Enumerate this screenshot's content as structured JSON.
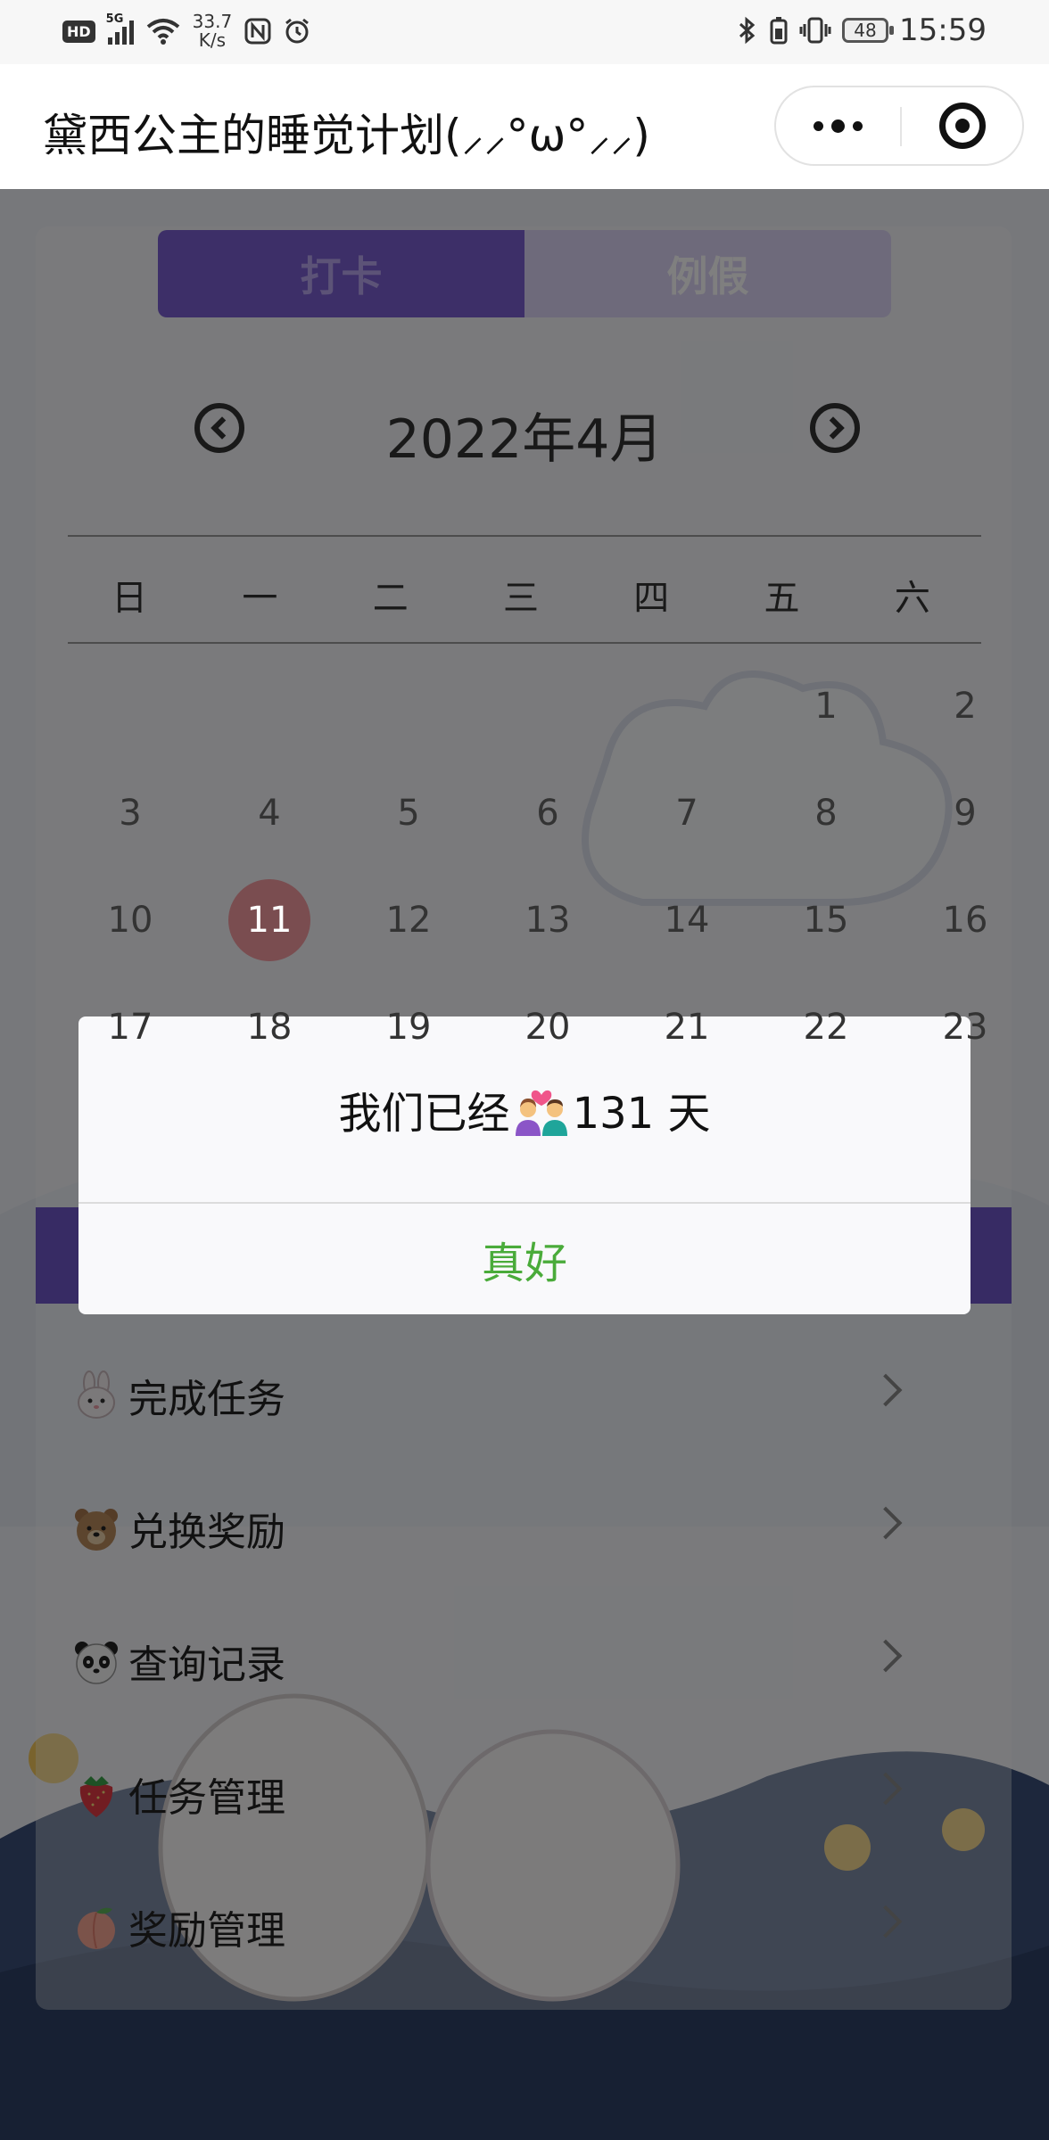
{
  "status_bar": {
    "hd": "HD",
    "network": "5G",
    "speed_value": "33.7",
    "speed_unit": "K/s",
    "battery": "48",
    "time": "15:59"
  },
  "nav": {
    "title": "黛西公主的睡觉计划(⸝⸝°ω°⸝⸝)"
  },
  "tabs": {
    "checkin": "打卡",
    "holiday": "例假"
  },
  "calendar": {
    "month_title": "2022年4月",
    "weekdays": [
      "日",
      "一",
      "二",
      "三",
      "四",
      "五",
      "六"
    ],
    "rows": [
      [
        "",
        "",
        "",
        "",
        "",
        "1",
        "2"
      ],
      [
        "3",
        "4",
        "5",
        "6",
        "7",
        "8",
        "9"
      ],
      [
        "10",
        "11",
        "12",
        "13",
        "14",
        "15",
        "16"
      ],
      [
        "17",
        "18",
        "19",
        "20",
        "21",
        "22",
        "23"
      ]
    ],
    "today": "11"
  },
  "menu": [
    {
      "icon": "rabbit-icon",
      "label": "完成任务"
    },
    {
      "icon": "bear-icon",
      "label": "兑换奖励"
    },
    {
      "icon": "panda-icon",
      "label": "查询记录"
    },
    {
      "icon": "strawberry-icon",
      "label": "任务管理"
    },
    {
      "icon": "peach-icon",
      "label": "奖励管理"
    }
  ],
  "dialog": {
    "message_prefix": "我们已经",
    "message_suffix": "131 天",
    "confirm": "真好"
  },
  "colors": {
    "accent": "#6f56c8",
    "confirm_green": "#4aab3a",
    "today_circle": "#f59aa0"
  }
}
